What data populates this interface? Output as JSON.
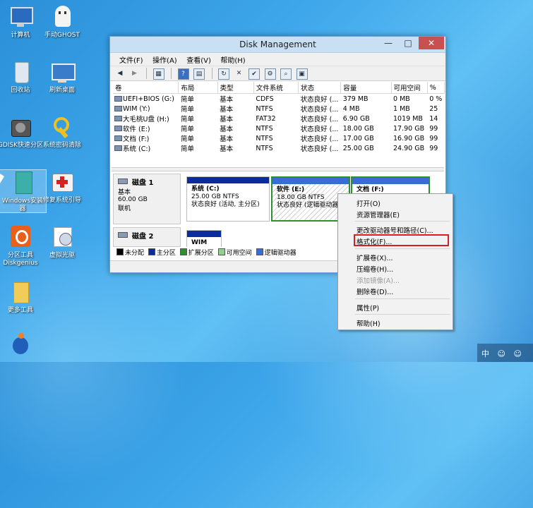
{
  "desktop": {
    "icons": [
      {
        "label": "计算机"
      },
      {
        "label": "手动GHOST"
      },
      {
        "label": "回收站"
      },
      {
        "label": "刷新桌面"
      },
      {
        "label": "GDISK快速分区"
      },
      {
        "label": "系统密码清除"
      },
      {
        "label": "Windows安装器"
      },
      {
        "label": "修复系统引导"
      },
      {
        "label": "分区工具Diskgenius"
      },
      {
        "label": "虚拟光驱"
      },
      {
        "label": "更多工具"
      }
    ]
  },
  "window": {
    "title": "Disk Management",
    "minimize": "—",
    "maximize": "□",
    "close": "✕",
    "menu": [
      "文件(F)",
      "操作(A)",
      "查看(V)",
      "帮助(H)"
    ],
    "toolbar_icons": [
      "back-icon",
      "forward-icon",
      "properties-icon",
      "help-icon",
      "refresh-icon",
      "delete-icon",
      "check-icon",
      "search-icon",
      "settings-icon"
    ],
    "columns": [
      "卷",
      "布局",
      "类型",
      "文件系统",
      "状态",
      "容量",
      "可用空间",
      "%"
    ],
    "volumes": [
      [
        "UEFI+BIOS (G:)",
        "简单",
        "基本",
        "CDFS",
        "状态良好 (...",
        "379 MB",
        "0 MB",
        "0 %"
      ],
      [
        "WIM (Y:)",
        "简单",
        "基本",
        "NTFS",
        "状态良好 (...",
        "4 MB",
        "1 MB",
        "25"
      ],
      [
        "大毛桃U盘 (H:)",
        "简单",
        "基本",
        "FAT32",
        "状态良好 (...",
        "6.90 GB",
        "1019 MB",
        "14"
      ],
      [
        "软件 (E:)",
        "简单",
        "基本",
        "NTFS",
        "状态良好 (...",
        "18.00 GB",
        "17.90 GB",
        "99"
      ],
      [
        "文档 (F:)",
        "简单",
        "基本",
        "NTFS",
        "状态良好 (...",
        "17.00 GB",
        "16.90 GB",
        "99"
      ],
      [
        "系统 (C:)",
        "简单",
        "基本",
        "NTFS",
        "状态良好 (...",
        "25.00 GB",
        "24.90 GB",
        "99"
      ]
    ],
    "disk1": {
      "name": "磁盘 1",
      "type": "基本",
      "size": "60.00 GB",
      "status": "联机",
      "c": {
        "name": "系统 (C:)",
        "size": "25.00 GB NTFS",
        "status": "状态良好 (活动, 主分区)"
      },
      "e": {
        "name": "软件 (E:)",
        "size": "18.00 GB NTFS",
        "status": "状态良好 (逻辑驱动器"
      },
      "f": {
        "name": "文档 (F:)"
      }
    },
    "disk2": {
      "name": "磁盘 2",
      "part": "WIM"
    },
    "legend": [
      "未分配",
      "主分区",
      "扩展分区",
      "可用空间",
      "逻辑驱动器"
    ],
    "legend_colors": [
      "#000000",
      "#0c2c9e",
      "#2f8f2f",
      "#8fd28f",
      "#3a6cd6"
    ]
  },
  "context_menu": {
    "items": [
      "打开(O)",
      "资源管理器(E)",
      "更改驱动器号和路径(C)...",
      "格式化(F)...",
      "扩展卷(X)...",
      "压缩卷(H)...",
      "添加镜像(A)...",
      "删除卷(D)...",
      "属性(P)",
      "帮助(H)"
    ]
  },
  "tray": {
    "ime": "中"
  }
}
